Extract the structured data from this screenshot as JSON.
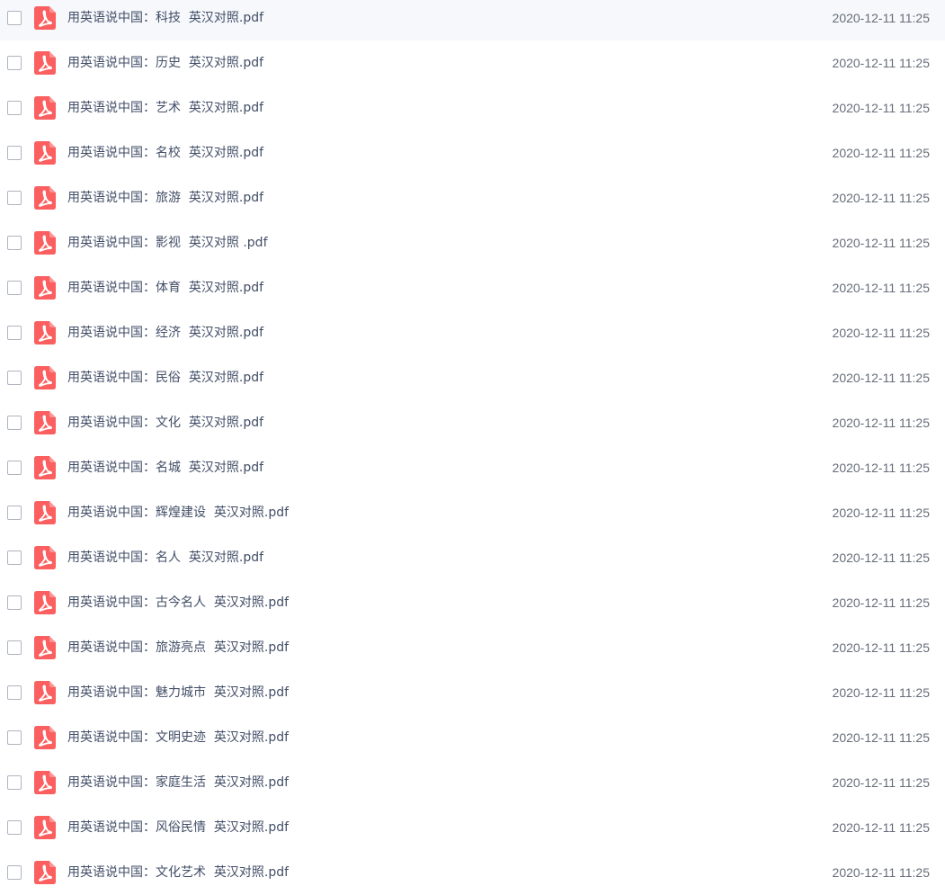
{
  "file_list": {
    "files": [
      {
        "name": "用英语说中国：科技  英汉对照.pdf",
        "time": "2020-12-11 11:25"
      },
      {
        "name": "用英语说中国：历史  英汉对照.pdf",
        "time": "2020-12-11 11:25"
      },
      {
        "name": "用英语说中国：艺术  英汉对照.pdf",
        "time": "2020-12-11 11:25"
      },
      {
        "name": "用英语说中国：名校  英汉对照.pdf",
        "time": "2020-12-11 11:25"
      },
      {
        "name": "用英语说中国：旅游  英汉对照.pdf",
        "time": "2020-12-11 11:25"
      },
      {
        "name": "用英语说中国：影视  英汉对照 .pdf",
        "time": "2020-12-11 11:25"
      },
      {
        "name": "用英语说中国：体育  英汉对照.pdf",
        "time": "2020-12-11 11:25"
      },
      {
        "name": "用英语说中国：经济  英汉对照.pdf",
        "time": "2020-12-11 11:25"
      },
      {
        "name": "用英语说中国：民俗  英汉对照.pdf",
        "time": "2020-12-11 11:25"
      },
      {
        "name": "用英语说中国：文化  英汉对照.pdf",
        "time": "2020-12-11 11:25"
      },
      {
        "name": "用英语说中国：名城  英汉对照.pdf",
        "time": "2020-12-11 11:25"
      },
      {
        "name": "用英语说中国：辉煌建设  英汉对照.pdf",
        "time": "2020-12-11 11:25"
      },
      {
        "name": "用英语说中国：名人  英汉对照.pdf",
        "time": "2020-12-11 11:25"
      },
      {
        "name": "用英语说中国：古今名人  英汉对照.pdf",
        "time": "2020-12-11 11:25"
      },
      {
        "name": "用英语说中国：旅游亮点  英汉对照.pdf",
        "time": "2020-12-11 11:25"
      },
      {
        "name": "用英语说中国：魅力城市  英汉对照.pdf",
        "time": "2020-12-11 11:25"
      },
      {
        "name": "用英语说中国：文明史迹  英汉对照.pdf",
        "time": "2020-12-11 11:25"
      },
      {
        "name": "用英语说中国：家庭生活  英汉对照.pdf",
        "time": "2020-12-11 11:25"
      },
      {
        "name": "用英语说中国：风俗民情  英汉对照.pdf",
        "time": "2020-12-11 11:25"
      },
      {
        "name": "用英语说中国：文化艺术  英汉对照.pdf",
        "time": "2020-12-11 11:25"
      }
    ],
    "icon": "pdf-file-icon",
    "colors": {
      "pdf_icon": "#fb5f5f",
      "text": "#424e67",
      "time": "#666d7a",
      "checkbox_border": "#aeb4bf"
    }
  }
}
